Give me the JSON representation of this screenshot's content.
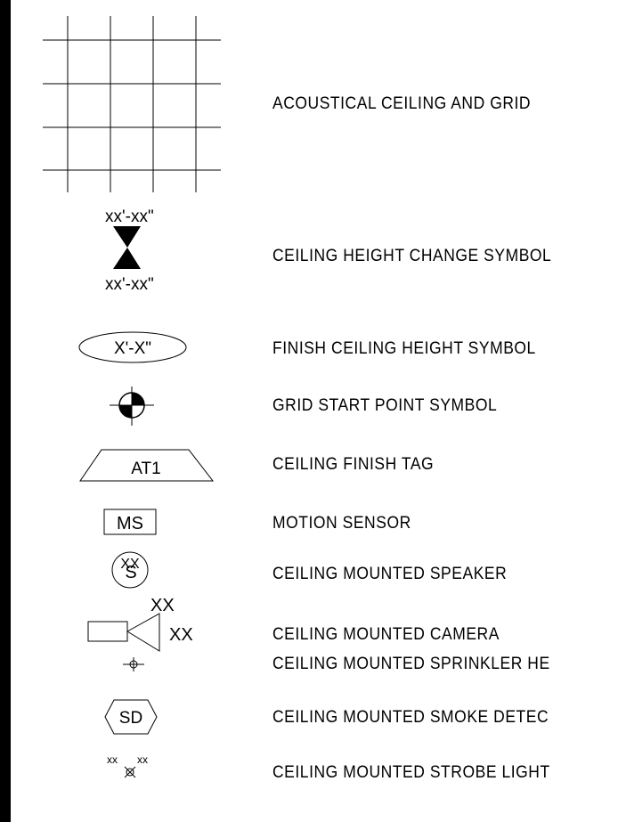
{
  "legend": [
    {
      "id": "acoustical",
      "label": "ACOUSTICAL CEILING AND GRID",
      "icon": "grid-icon"
    },
    {
      "id": "height-change",
      "label": "CEILING HEIGHT CHANGE SYMBOL",
      "icon": "hourglass-icon",
      "top_text": "xx'-xx\"",
      "bottom_text": "xx'-xx\""
    },
    {
      "id": "finish-height",
      "label": "FINISH CEILING HEIGHT SYMBOL",
      "icon": "ellipse-icon",
      "text": "X'-X\""
    },
    {
      "id": "grid-start",
      "label": "GRID START POINT SYMBOL",
      "icon": "grid-start-icon"
    },
    {
      "id": "finish-tag",
      "label": "CEILING FINISH TAG",
      "icon": "trapezoid-icon",
      "text": "AT1"
    },
    {
      "id": "motion",
      "label": "MOTION SENSOR",
      "icon": "motion-sensor-icon",
      "text": "MS"
    },
    {
      "id": "speaker",
      "label": "CEILING MOUNTED SPEAKER",
      "icon": "speaker-icon",
      "text_s": "S",
      "text_xx": "XX"
    },
    {
      "id": "camera",
      "label": "CEILING MOUNTED CAMERA",
      "icon": "camera-icon",
      "text_top": "XX",
      "text_right": "XX"
    },
    {
      "id": "sprinkler",
      "label": "CEILING MOUNTED SPRINKLER HE",
      "icon": "sprinkler-icon"
    },
    {
      "id": "smoke",
      "label": "CEILING MOUNTED SMOKE DETEC",
      "icon": "smoke-detector-icon",
      "text": "SD"
    },
    {
      "id": "strobe",
      "label": "CEILING MOUNTED STROBE LIGHT",
      "icon": "strobe-icon",
      "text_left": "xx",
      "text_right": "xx"
    }
  ]
}
